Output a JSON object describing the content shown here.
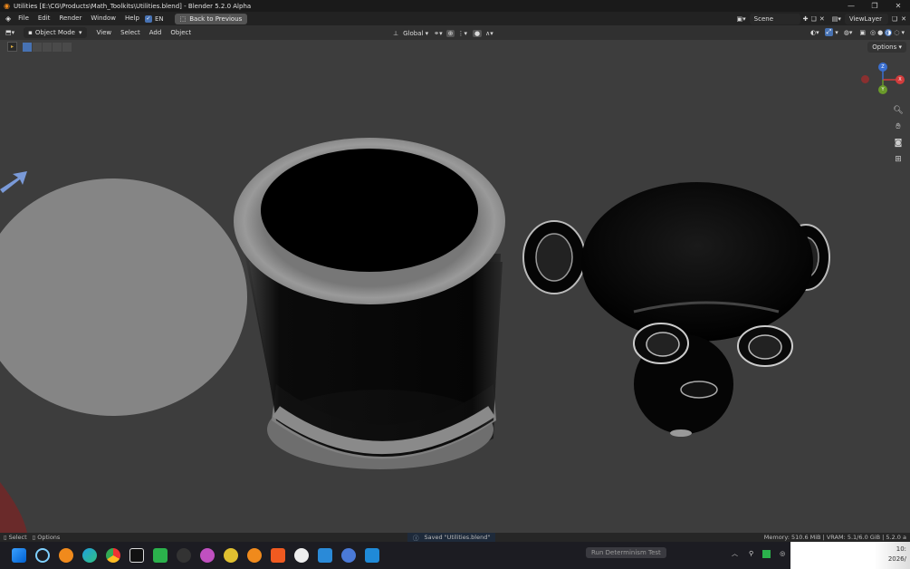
{
  "titlebar": {
    "title": "Utilities [E:\\CG\\Products\\Math_Toolkits\\Utilities.blend] - Blender 5.2.0 Alpha"
  },
  "menubar": {
    "items": [
      "File",
      "Edit",
      "Render",
      "Window",
      "Help"
    ],
    "lang_label": "EN",
    "back_button": "Back to Previous",
    "scene_label": "Scene",
    "viewlayer_label": "ViewLayer"
  },
  "header": {
    "mode": "Object Mode",
    "menus": [
      "View",
      "Select",
      "Add",
      "Object"
    ],
    "orientation": "Global",
    "options_label": "Options"
  },
  "gizmo": {
    "z": "Z",
    "x": "X",
    "y": "Y"
  },
  "statusbar": {
    "select_label": "Select",
    "options_label": "Options",
    "saved_message": "Saved \"Utilities.blend\"",
    "memory": "Memory: 510.6 MiB | VRAM: 5.1/6.0 GiB | 5.2.0 a"
  },
  "taskbar": {
    "run_test_label": "Run Determinism Test",
    "clock_time": "10:",
    "clock_date": "2026/"
  },
  "colors": {
    "accent": "#4772b3",
    "gizmo_x": "#d23c3c",
    "gizmo_y": "#6a9a2a",
    "gizmo_z": "#3a6fd0"
  }
}
